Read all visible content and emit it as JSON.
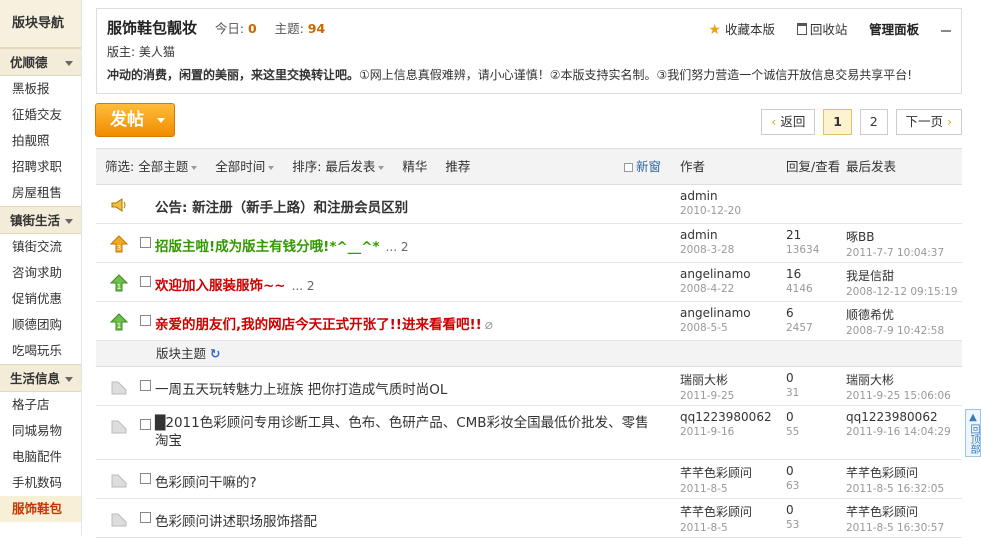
{
  "sidebar": {
    "title": "版块导航",
    "groups": [
      {
        "label": "优顺德",
        "items": [
          "黑板报",
          "征婚交友",
          "拍靓照",
          "招聘求职",
          "房屋租售"
        ]
      },
      {
        "label": "镇街生活",
        "items": [
          "镇街交流",
          "咨询求助",
          "促销优惠",
          "顺德团购",
          "吃喝玩乐"
        ]
      },
      {
        "label": "生活信息",
        "items": [
          "格子店",
          "同城易物",
          "电脑配件",
          "手机数码",
          "服饰鞋包"
        ]
      }
    ]
  },
  "forum": {
    "title": "服饰鞋包靓妆",
    "today_label": "今日:",
    "today": "0",
    "threads_label": "主题:",
    "threads": "94",
    "moderators": "版主: 美人猫",
    "desc_bold": "冲动的消费，闲置的美丽，来这里交换转让吧。",
    "desc_rest": "①网上信息真假难辨，请小心谨慎！②本版支持实名制。③我们努力营造一个诚信开放信息交易共享平台!",
    "actions": {
      "favorite": "收藏本版",
      "recycle": "回收站",
      "manage": "管理面板"
    }
  },
  "toolbar": {
    "post": "发帖"
  },
  "pager": {
    "back": "返回",
    "pages": [
      "1",
      "2"
    ],
    "next": "下一页"
  },
  "filters": {
    "label": "筛选:",
    "all_threads": "全部主题",
    "all_time": "全部时间",
    "sort": "排序: 最后发表",
    "digest": "精华",
    "recommend": "推荐",
    "new": "新窗",
    "col_author": "作者",
    "col_replies": "回复/查看",
    "col_last": "最后发表"
  },
  "threads": [
    {
      "type": "announce",
      "subject": "公告: 新注册（新手上路）和注册会员区别",
      "style": "bold",
      "author": "admin",
      "date": "2010-12-20",
      "replies": "",
      "views": "",
      "last_user": "",
      "last_time": "",
      "pages": ""
    },
    {
      "type": "sticky3",
      "subject": "招版主啦!成为版主有钱分哦!*^__^*",
      "style": "green",
      "pages": "... 2",
      "author": "admin",
      "date": "2008-3-28",
      "replies": "21",
      "views": "13634",
      "last_user": "啄BB",
      "last_time": "2011-7-7 10:04:37"
    },
    {
      "type": "sticky1",
      "subject": "欢迎加入服装服饰~~",
      "style": "red",
      "pages": "... 2",
      "author": "angelinamo",
      "date": "2008-4-22",
      "replies": "16",
      "views": "4146",
      "last_user": "我是信甜",
      "last_time": "2008-12-12 09:15:19"
    },
    {
      "type": "sticky1",
      "subject": "亲爱的朋友们,我的网店今天正式开张了!!进来看看吧!!",
      "style": "red",
      "pages": "",
      "author": "angelinamo",
      "date": "2008-5-5",
      "replies": "6",
      "views": "2457",
      "last_user": "顺德希优",
      "last_time": "2008-7-9 10:42:58"
    }
  ],
  "section_label": "版块主题",
  "normal_threads": [
    {
      "subject": "一周五天玩转魅力上班族 把你打造成气质时尚OL",
      "author": "瑞丽大彬",
      "date": "2011-9-25",
      "replies": "0",
      "views": "31",
      "last_user": "瑞丽大彬",
      "last_time": "2011-9-25 15:06:06"
    },
    {
      "subject": "█2011色彩顾问专用诊断工具、色布、色研产品、CMB彩妆全国最低价批发、零售淘宝",
      "line1": "█2011色彩顾问专用诊断工具、色布、色研产品、CMB彩妆全国最低价批发、零售",
      "line2": "淘宝",
      "author": "qq1223980062",
      "date": "2011-9-16",
      "replies": "0",
      "views": "55",
      "last_user": "qq1223980062",
      "last_time": "2011-9-16 14:04:29"
    },
    {
      "subject": "色彩顾问干嘛的?",
      "author": "芊芊色彩顾问",
      "date": "2011-8-5",
      "replies": "0",
      "views": "63",
      "last_user": "芊芊色彩顾问",
      "last_time": "2011-8-5 16:32:05"
    },
    {
      "subject": "色彩顾问讲述职场服饰搭配",
      "author": "芊芊色彩顾问",
      "date": "2011-8-5",
      "replies": "0",
      "views": "53",
      "last_user": "芊芊色彩顾问",
      "last_time": "2011-8-5 16:30:57"
    }
  ],
  "back_top": "回顶部",
  "colors": {
    "accent": "#f08d00",
    "sticky_green": "#339900",
    "sticky_red": "#cc0000",
    "link_blue": "#336699"
  }
}
